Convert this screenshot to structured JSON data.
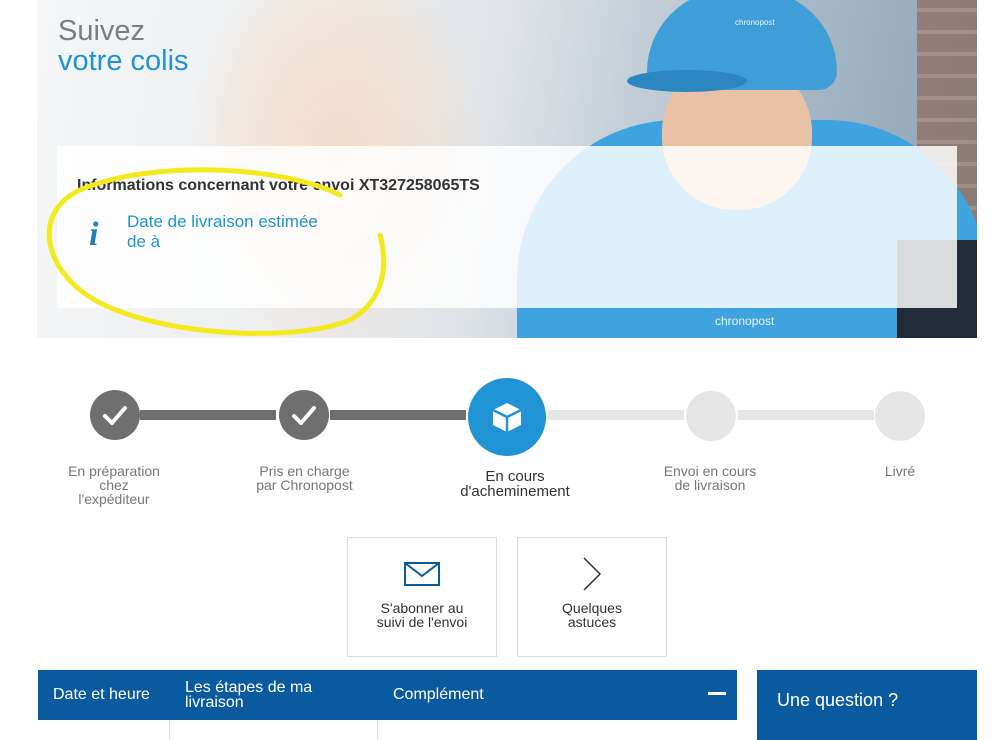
{
  "hero": {
    "title_line1": "Suivez",
    "title_line2": "votre colis",
    "brand": "chronopost"
  },
  "info": {
    "title": "Informations concernant votre envoi XT327258065TS",
    "line1": "Date de livraison estimée",
    "line2": "de à",
    "icon": "info-icon"
  },
  "steps": [
    {
      "line1": "En préparation",
      "line2": "chez",
      "line3": "l'expéditeur",
      "state": "done"
    },
    {
      "line1": "Pris en charge",
      "line2": "par Chronopost",
      "line3": "",
      "state": "done"
    },
    {
      "line1": "En cours",
      "line2": "d'acheminement",
      "line3": "",
      "state": "active"
    },
    {
      "line1": "Envoi en cours",
      "line2": "de livraison",
      "line3": "",
      "state": "pending"
    },
    {
      "line1": "Livré",
      "line2": "",
      "line3": "",
      "state": "pending"
    }
  ],
  "cards": {
    "subscribe": {
      "line1": "S'abonner au",
      "line2": "suivi de l'envoi",
      "icon": "envelope-icon"
    },
    "tips": {
      "line1": "Quelques",
      "line2": "astuces",
      "icon": "chevron-right-icon"
    }
  },
  "table": {
    "headers": {
      "date": "Date et heure",
      "steps_line1": "Les étapes de ma",
      "steps_line2": "livraison",
      "complement": "Complément"
    },
    "toggle_icon": "minus-icon"
  },
  "question": {
    "label": "Une question ?"
  },
  "colors": {
    "accent": "#1f93d4",
    "done": "#6f6f6f",
    "pending": "#e6e6e6",
    "header": "#0a5aa0",
    "highlight": "#f2ea1d"
  }
}
